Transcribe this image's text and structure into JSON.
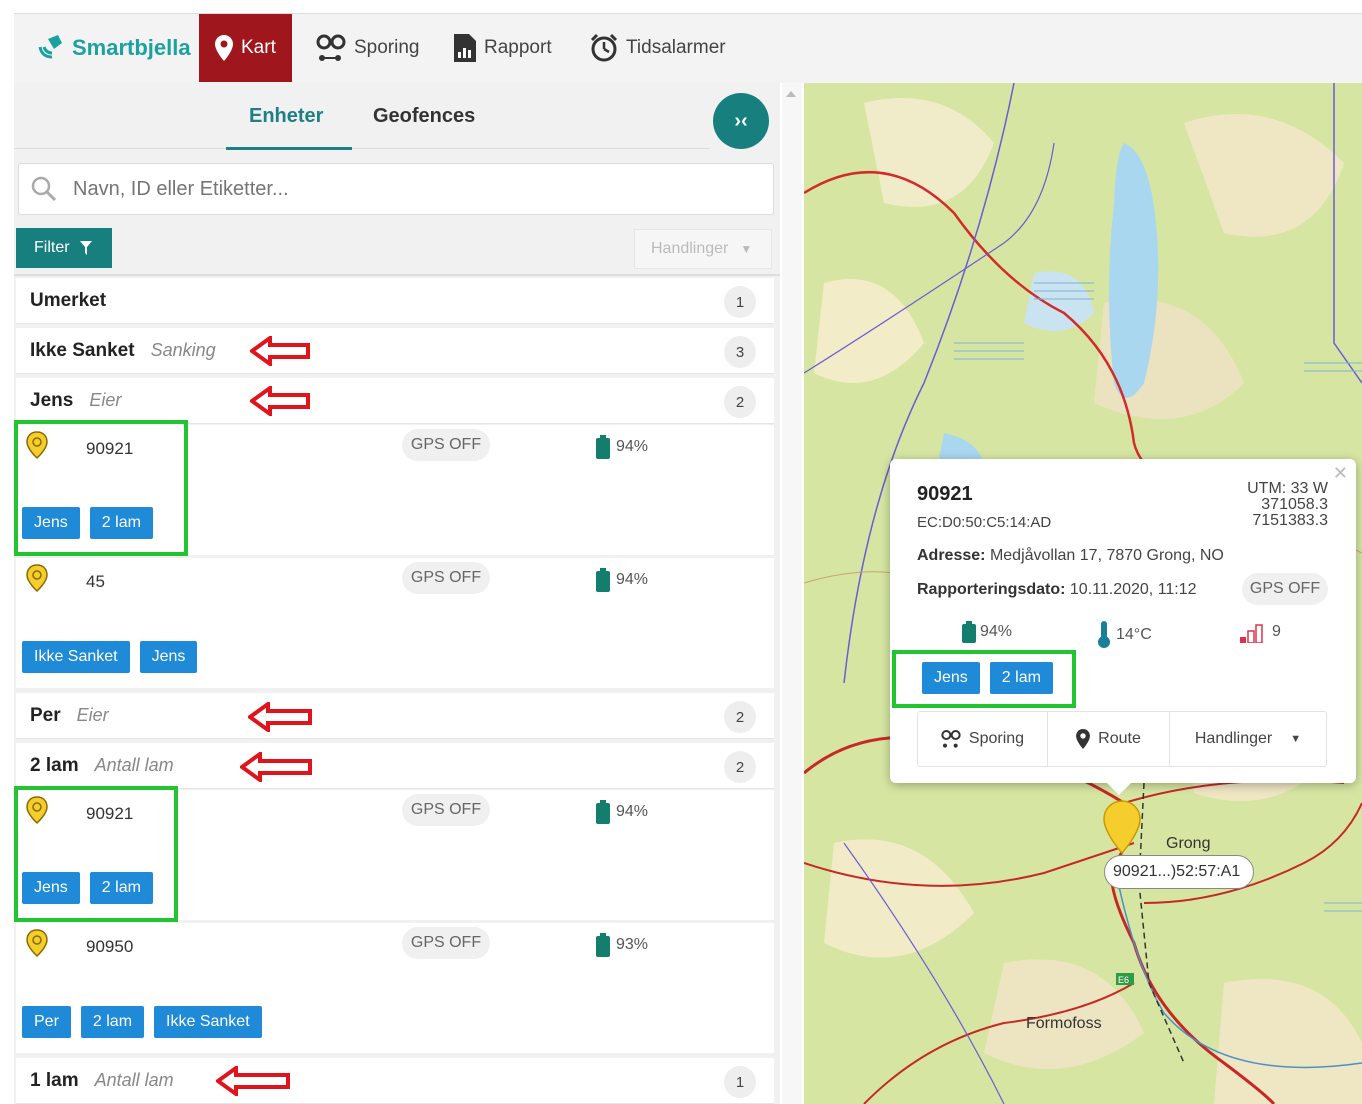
{
  "app": {
    "brand": "Smartbjella",
    "nav": [
      {
        "label": "Kart",
        "icon": "map-pin-icon",
        "active": true
      },
      {
        "label": "Sporing",
        "icon": "tracking-icon"
      },
      {
        "label": "Rapport",
        "icon": "report-icon"
      },
      {
        "label": "Tidsalarmer",
        "icon": "alarm-clock-icon"
      }
    ],
    "accent": "#a0161d",
    "teal": "#17807f"
  },
  "left": {
    "tabs": [
      {
        "label": "Enheter",
        "active": true
      },
      {
        "label": "Geofences"
      }
    ],
    "search_placeholder": "Navn, ID eller Etiketter...",
    "filter_label": "Filter",
    "actions_label": "Handlinger",
    "groups": [
      {
        "name": "Umerket",
        "sub": "",
        "count": "1"
      },
      {
        "name": "Ikke Sanket",
        "sub": "Sanking",
        "count": "3"
      },
      {
        "name": "Jens",
        "sub": "Eier",
        "count": "2"
      },
      {
        "name": "Per",
        "sub": "Eier",
        "count": "2"
      },
      {
        "name": "2 lam",
        "sub": "Antall lam",
        "count": "2"
      },
      {
        "name": "1 lam",
        "sub": "Antall lam",
        "count": "1"
      }
    ],
    "devices": [
      {
        "id": "90921",
        "gps": "GPS OFF",
        "battery": "94%",
        "tags": [
          "Jens",
          "2 lam"
        ]
      },
      {
        "id": "45",
        "gps": "GPS OFF",
        "battery": "94%",
        "tags": [
          "Ikke Sanket",
          "Jens"
        ]
      },
      {
        "id": "90921",
        "gps": "GPS OFF",
        "battery": "94%",
        "tags": [
          "Jens",
          "2 lam"
        ]
      },
      {
        "id": "90950",
        "gps": "GPS OFF",
        "battery": "93%",
        "tags": [
          "Per",
          "2 lam",
          "Ikke Sanket"
        ]
      }
    ]
  },
  "popup": {
    "title": "90921",
    "mac": "EC:D0:50:C5:14:AD",
    "utm": [
      "UTM: 33 W",
      "371058.3",
      "7151383.3"
    ],
    "address_label": "Adresse:",
    "address": "Medjåvollan 17, 7870 Grong, NO",
    "date_label": "Rapporteringsdato:",
    "date": "10.11.2020, 11:12",
    "gps": "GPS OFF",
    "battery": "94%",
    "temperature": "14°C",
    "signal": "9",
    "tags": [
      "Jens",
      "2 lam"
    ],
    "buttons": {
      "sporing": "Sporing",
      "route": "Route",
      "handlinger": "Handlinger"
    }
  },
  "map": {
    "marker_label": "90921...)52:57:A1",
    "places": [
      "Grong",
      "Formofoss"
    ],
    "road": "E6"
  }
}
